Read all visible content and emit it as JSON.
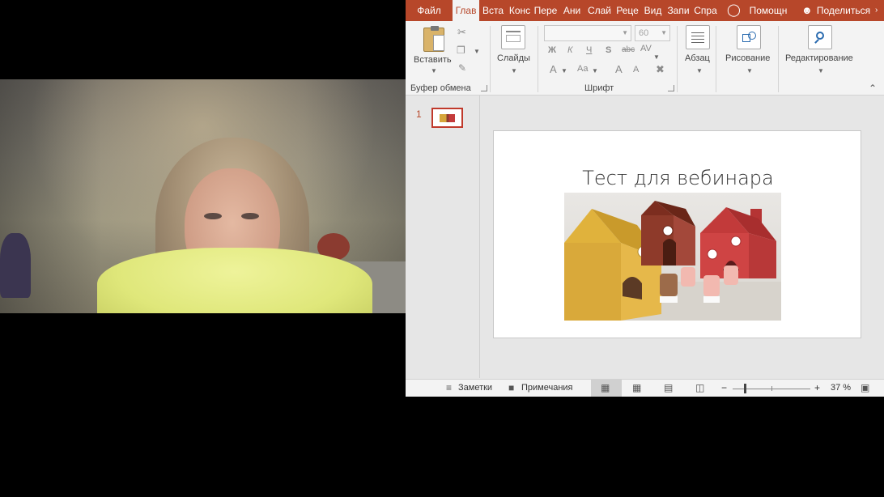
{
  "ribbon_tabs": [
    {
      "label": "Файл",
      "active": false
    },
    {
      "label": "Глав",
      "active": true
    },
    {
      "label": "Вста",
      "active": false
    },
    {
      "label": "Конс",
      "active": false
    },
    {
      "label": "Пере",
      "active": false
    },
    {
      "label": "Ани",
      "active": false
    },
    {
      "label": "Слай",
      "active": false
    },
    {
      "label": "Реце",
      "active": false
    },
    {
      "label": "Вид",
      "active": false
    },
    {
      "label": "Запи",
      "active": false
    },
    {
      "label": "Спра",
      "active": false
    }
  ],
  "help_label": "Помощн",
  "share_label": "Поделиться",
  "clipboard": {
    "paste_label": "Вставить",
    "group_label": "Буфер обмена"
  },
  "slides_label": "Слайды",
  "font": {
    "font_name": "",
    "font_size": "60",
    "bold": "Ж",
    "italic": "К",
    "underline": "Ч",
    "shadow": "S",
    "strike": "abc",
    "spacing": "AV",
    "font_color": "A",
    "change_case": "Aa",
    "grow": "A",
    "shrink": "A",
    "group_label": "Шрифт"
  },
  "paragraph_label": "Абзац",
  "drawing_label": "Рисование",
  "editing_label": "Редактирование",
  "thumbnail": {
    "number": "1"
  },
  "slide": {
    "title": "Тест для вебинара",
    "image_description": "three paper houses with pig figurines"
  },
  "status_bar": {
    "notes_label": "Заметки",
    "comments_label": "Примечания",
    "zoom_minus": "−",
    "zoom_plus": "+",
    "zoom_level": "37 %"
  },
  "colors": {
    "accent": "#b7472a",
    "ribbon_bg": "#f3f3f3",
    "workspace_bg": "#e6e6e6"
  }
}
